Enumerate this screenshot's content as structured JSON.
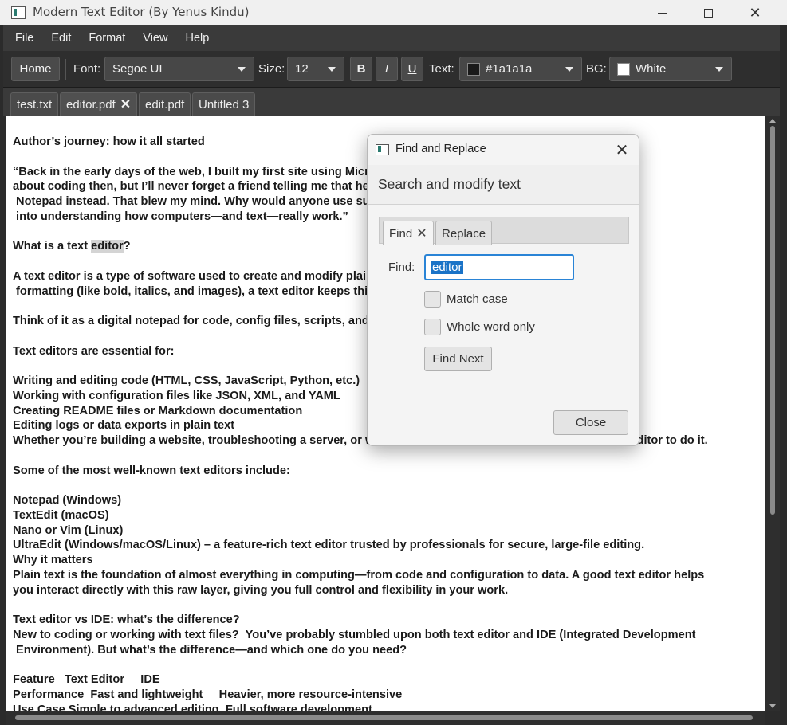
{
  "window": {
    "title": "Modern Text Editor (By Yenus Kindu)",
    "controls": [
      "minimize",
      "maximize",
      "close"
    ]
  },
  "menu": [
    "File",
    "Edit",
    "Format",
    "View",
    "Help"
  ],
  "toolbar": {
    "home_label": "Home",
    "font_label": "Font:",
    "font_value": "Segoe UI",
    "size_label": "Size:",
    "size_value": "12",
    "bold_label": "B",
    "italic_label": "I",
    "underline_label": "U",
    "text_color_label": "Text:",
    "text_color_value": "#1a1a1a",
    "bg_label": "BG:",
    "bg_value": "White"
  },
  "tabs": [
    {
      "label": "test.txt",
      "active": false
    },
    {
      "label": "editor.pdf",
      "active": true
    },
    {
      "label": "edit.pdf",
      "active": false
    },
    {
      "label": "Untitled 3",
      "active": false
    }
  ],
  "editor": {
    "lines": [
      "Author’s journey: how it all started",
      "",
      "“Back in the early days of the web, I built my first site using Microsoft FrontPage. I didn’t know much",
      "about coding then, but I’ll never forget a friend telling me that he did everything by hand-coding CSS in",
      " Notepad instead. That blew my mind. Why would anyone use such a tool? That curiosity launched my journey",
      " into understanding how computers—and text—really work.”",
      "",
      "What is a text ",
      "",
      "A text editor is a type of software used to create and modify plain text files. Unlike Microsoft Word, which add",
      " formatting (like bold, italics, and images), a text editor keeps things simple: just raw text.",
      "",
      "Think of it as a digital notepad for code, config files, scripts, and more.",
      "",
      "Text editors are essential for:",
      "",
      "Writing and editing code (HTML, CSS, JavaScript, Python, etc.)",
      "Working with configuration files like JSON, XML, and YAML",
      "Creating README files or Markdown documentation",
      "Editing logs or data exports in plain text",
      "Whether you’re building a website, troubleshooting a server, or writing a guide, chances are you’re using a text editor to do it.",
      "",
      "Some of the most well-known text editors include:",
      "",
      "Notepad (Windows)",
      "TextEdit (macOS)",
      "Nano or Vim (Linux)",
      "UltraEdit (Windows/macOS/Linux) – a feature-rich text editor trusted by professionals for secure, large-file editing.",
      "Why it matters",
      "Plain text is the foundation of almost everything in computing—from code and configuration to data. A good text editor helps",
      "you interact directly with this raw layer, giving you full control and flexibility in your work.",
      "",
      "Text editor vs IDE: what’s the difference?",
      "New to coding or working with text files?  You’ve probably stumbled upon both text editor and IDE (Integrated Development",
      " Environment). But what’s the difference—and which one do you need?",
      "",
      "Feature   Text Editor     IDE",
      "Performance  Fast and lightweight     Heavier, more resource-intensive",
      "Use Case Simple to advanced editing  Full software development"
    ],
    "highlight_word": "editor",
    "highlight_suffix": "?"
  },
  "dialog": {
    "title": "Find and Replace",
    "header": "Search and modify text",
    "tabs": [
      {
        "label": "Find",
        "active": true
      },
      {
        "label": "Replace",
        "active": false
      }
    ],
    "find_label": "Find:",
    "find_value": "editor",
    "match_case_label": "Match case",
    "match_case_checked": false,
    "whole_word_label": "Whole word only",
    "whole_word_checked": false,
    "find_next_label": "Find Next",
    "close_label": "Close"
  },
  "colors": {
    "menubar_bg": "#3a3a3a",
    "toolbar_bg": "#2e2e2e",
    "editor_bg": "#ffffff",
    "text_color": "#1a1a1a",
    "selection_color": "#1a73c7",
    "focus_border": "#2a84d6"
  }
}
